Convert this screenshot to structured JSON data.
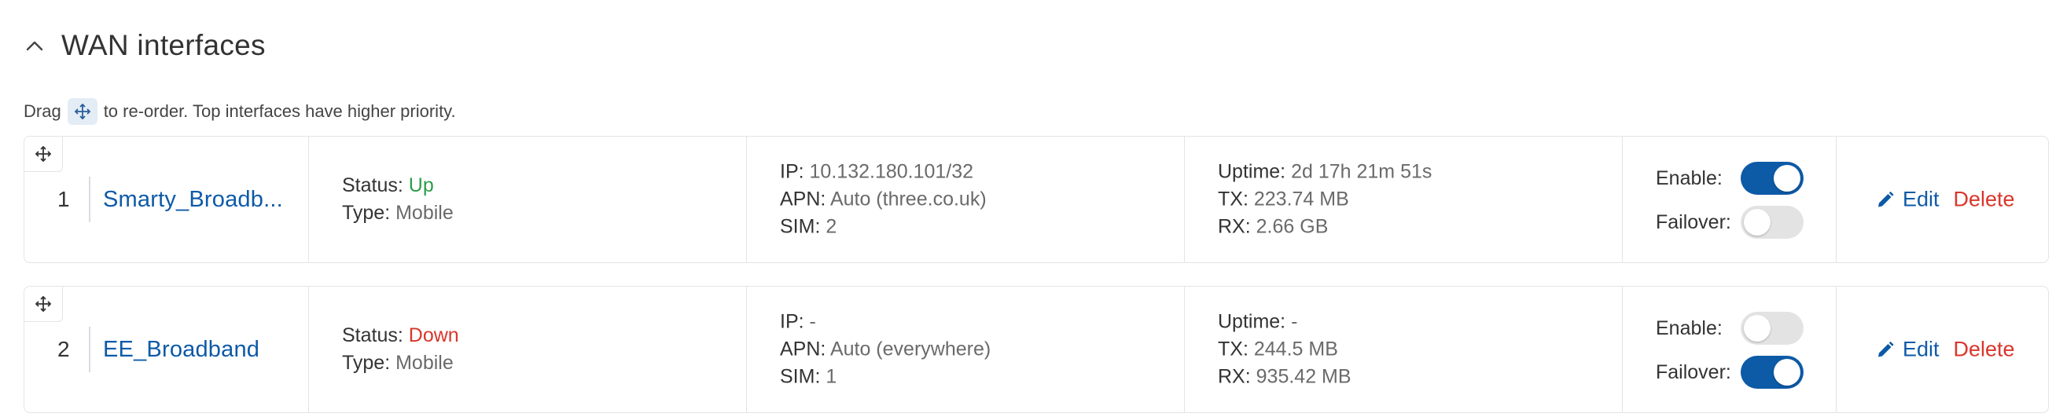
{
  "section": {
    "title": "WAN interfaces",
    "hint_before": "Drag",
    "hint_after": "to re-order. Top interfaces have higher priority."
  },
  "labels": {
    "status": "Status:",
    "type": "Type:",
    "ip": "IP:",
    "apn": "APN:",
    "sim": "SIM:",
    "uptime": "Uptime:",
    "tx": "TX:",
    "rx": "RX:",
    "enable": "Enable:",
    "failover": "Failover:",
    "edit": "Edit",
    "delete": "Delete"
  },
  "interfaces": [
    {
      "priority": "1",
      "name": "Smarty_Broadb...",
      "status": "Up",
      "type": "Mobile",
      "ip": "10.132.180.101/32",
      "apn": "Auto (three.co.uk)",
      "sim": "2",
      "uptime": "2d 17h 21m 51s",
      "tx": "223.74 MB",
      "rx": "2.66 GB",
      "enable": true,
      "failover": false
    },
    {
      "priority": "2",
      "name": "EE_Broadband",
      "status": "Down",
      "type": "Mobile",
      "ip": "-",
      "apn": "Auto (everywhere)",
      "sim": "1",
      "uptime": "-",
      "tx": "244.5 MB",
      "rx": "935.42 MB",
      "enable": false,
      "failover": true
    }
  ],
  "colors": {
    "accent": "#0d5aa7",
    "status_up": "#2e9c4a",
    "status_down": "#d9362b",
    "delete": "#d9362b"
  }
}
